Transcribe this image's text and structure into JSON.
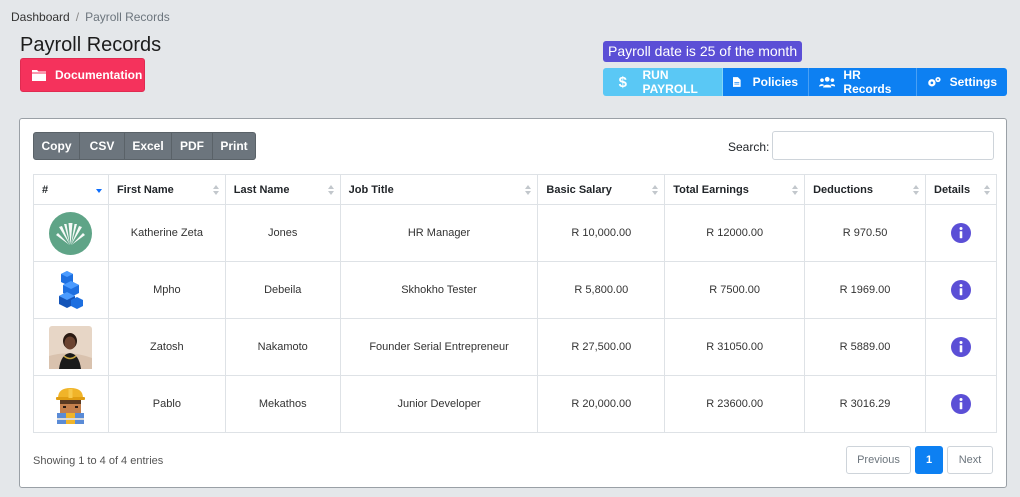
{
  "breadcrumb": {
    "home": "Dashboard",
    "current": "Payroll Records"
  },
  "page": {
    "title": "Payroll Records",
    "documentation_label": "Documentation",
    "payroll_date_note": "Payroll date is 25 of the month"
  },
  "actions": {
    "run_payroll": "RUN PAYROLL",
    "policies": "Policies",
    "hr_records": "HR Records",
    "settings": "Settings"
  },
  "exports": [
    "Copy",
    "CSV",
    "Excel",
    "PDF",
    "Print"
  ],
  "search": {
    "label": "Search:",
    "value": ""
  },
  "table": {
    "headers": [
      "#",
      "First Name",
      "Last Name",
      "Job Title",
      "Basic Salary",
      "Total Earnings",
      "Deductions",
      "Details"
    ],
    "rows": [
      {
        "avatar": "aloe-plant-avatar",
        "first": "Katherine Zeta",
        "last": "Jones",
        "job": "HR Manager",
        "basic": "R 10,000.00",
        "earnings": "R 12000.00",
        "deductions": "R 970.50"
      },
      {
        "avatar": "blue-blocks-avatar",
        "first": "Mpho",
        "last": "Debeila",
        "job": "Skhokho Tester",
        "basic": "R 5,800.00",
        "earnings": "R 7500.00",
        "deductions": "R 1969.00"
      },
      {
        "avatar": "person-photo-avatar",
        "first": "Zatosh",
        "last": "Nakamoto",
        "job": "Founder Serial Entrepreneur",
        "basic": "R 27,500.00",
        "earnings": "R 31050.00",
        "deductions": "R 5889.00"
      },
      {
        "avatar": "construction-worker-avatar",
        "first": "Pablo",
        "last": "Mekathos",
        "job": "Junior Developer",
        "basic": "R 20,000.00",
        "earnings": "R 23600.00",
        "deductions": "R 3016.29"
      }
    ]
  },
  "footer": {
    "showing": "Showing 1 to 4 of 4 entries",
    "previous": "Previous",
    "page": "1",
    "next": "Next"
  },
  "colors": {
    "documentation": "#f5325c",
    "run_payroll": "#5ac8f5",
    "primary": "#0d80f2",
    "payroll_note": "#5b4fd6",
    "info_icon": "#5b4fd6"
  }
}
